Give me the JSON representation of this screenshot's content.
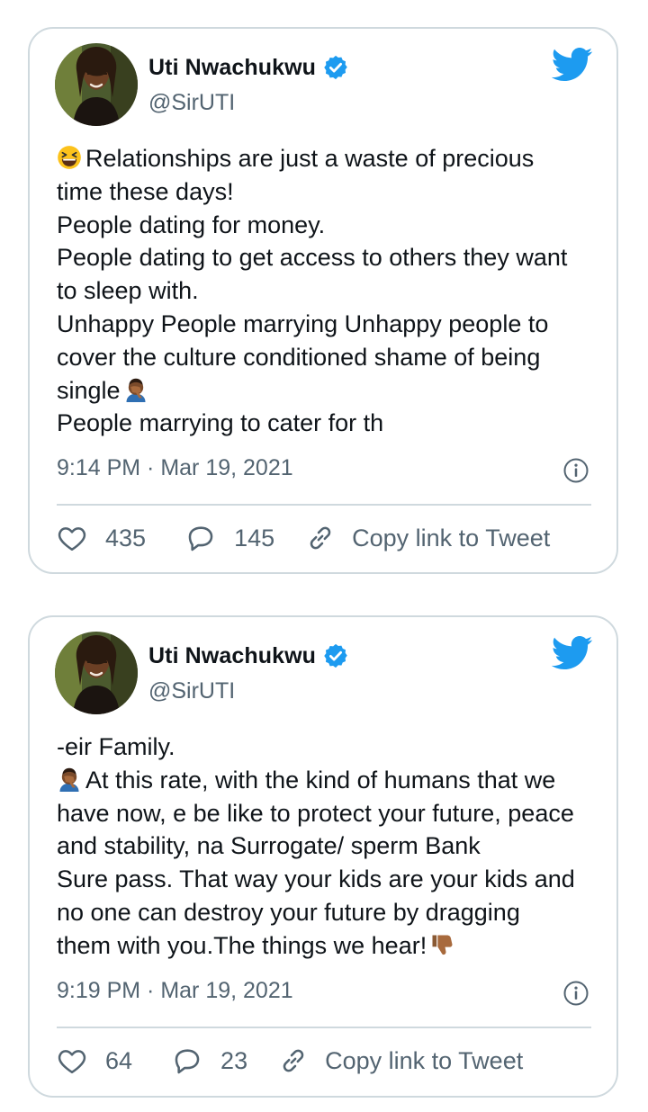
{
  "tweets": [
    {
      "author": {
        "name": "Uti Nwachukwu",
        "handle": "@SirUTI"
      },
      "lines": [
        {
          "text": "Relationships are just a waste of precious",
          "emoji_before": "grinning-squinting-face"
        },
        {
          "text": "time these days!"
        },
        {
          "text": "People dating for money."
        },
        {
          "text": "People dating to get access to others they want"
        },
        {
          "text": "to sleep with."
        },
        {
          "text": "Unhappy People marrying Unhappy people to"
        },
        {
          "text": "cover the culture conditioned shame of being"
        },
        {
          "text": "single",
          "emoji_after": "man-facepalming"
        },
        {
          "text": "People marrying to cater for th"
        }
      ],
      "timestamp": "9:14 PM · Mar 19, 2021",
      "likes": "435",
      "replies": "145",
      "copy_link_label": "Copy link to Tweet"
    },
    {
      "author": {
        "name": "Uti Nwachukwu",
        "handle": "@SirUTI"
      },
      "lines": [
        {
          "text": "-eir Family."
        },
        {
          "text": "At this rate, with the kind of humans that we",
          "emoji_before": "man-facepalming"
        },
        {
          "text": "have now, e be like to protect your future, peace"
        },
        {
          "text": "and stability, na Surrogate/ sperm Bank"
        },
        {
          "text": "Sure pass. That way your kids are your kids and"
        },
        {
          "text": "no one can destroy your future by dragging"
        },
        {
          "text": "them with you.The things we hear!",
          "emoji_after": "thumbs-down"
        }
      ],
      "timestamp": "9:19 PM · Mar 19, 2021",
      "likes": "64",
      "replies": "23",
      "copy_link_label": "Copy link to Tweet"
    }
  ],
  "colors": {
    "brand_blue": "#1d9bf0",
    "text": "#0f1419",
    "secondary": "#536471",
    "border": "#cfd9de"
  }
}
